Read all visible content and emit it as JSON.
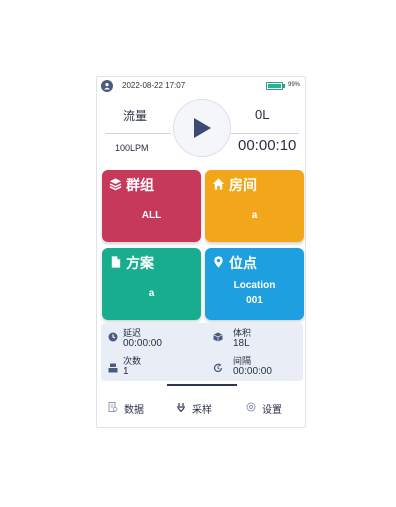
{
  "status": {
    "datetime": "2022-08-22 17:07",
    "battery_percent": "99%",
    "battery_level": 0.99
  },
  "header": {
    "flow_label": "流量",
    "flow_rate": "100LPM",
    "volume": "0L",
    "timer": "00:00:10"
  },
  "tiles": {
    "group": {
      "title": "群组",
      "value": "ALL",
      "color": "#c6395a"
    },
    "room": {
      "title": "房间",
      "value": "a",
      "color": "#f2a71b"
    },
    "plan": {
      "title": "方案",
      "value": "a",
      "color": "#18ad8f"
    },
    "location": {
      "title": "位点",
      "value_line1": "Location",
      "value_line2": "001",
      "color": "#1e9fdf"
    }
  },
  "info": {
    "delay_label": "延迟",
    "delay_value": "00:00:00",
    "volume_label": "体积",
    "volume_value": "18L",
    "count_label": "次数",
    "count_value": "1",
    "interval_label": "间隔",
    "interval_value": "00:00:00"
  },
  "nav": {
    "data_label": "数据",
    "sampling_label": "采样",
    "settings_label": "设置"
  },
  "colors": {
    "primary_text": "#2a2f45",
    "accent": "#2b3551",
    "info_bg": "#e8edf6"
  }
}
